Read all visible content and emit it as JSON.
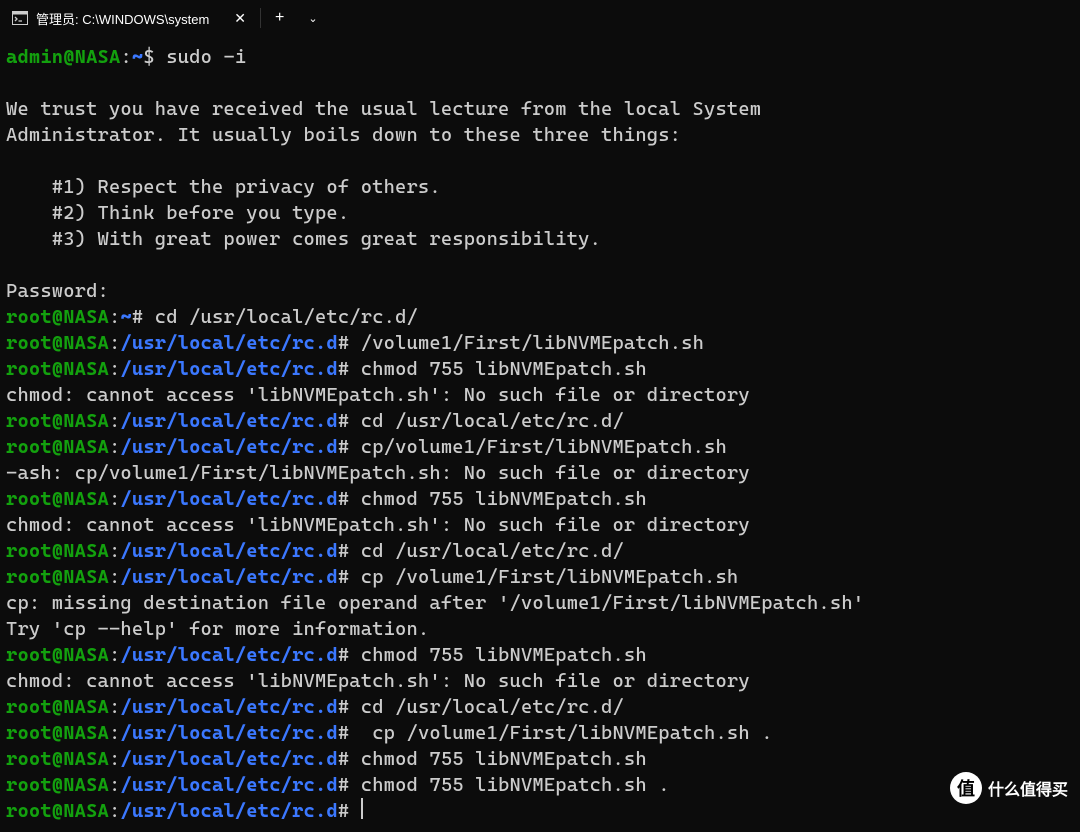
{
  "titlebar": {
    "tab_title": "管理员: C:\\WINDOWS\\system",
    "close_glyph": "✕",
    "new_glyph": "+",
    "dropdown_glyph": "⌄"
  },
  "prompts": {
    "admin_user": "admin@NASA",
    "admin_host_sep": ":",
    "admin_tilde": "~",
    "admin_dollar": "$",
    "root_user": "root@NASA",
    "root_tilde": "~",
    "root_hash": "#",
    "root_path": "/usr/local/etc/rc.d"
  },
  "lines": {
    "cmd_sudo": " sudo -i",
    "blank": "",
    "lecture1": "We trust you have received the usual lecture from the local System",
    "lecture2": "Administrator. It usually boils down to these three things:",
    "lecture3": "    #1) Respect the privacy of others.",
    "lecture4": "    #2) Think before you type.",
    "lecture5": "    #3) With great power comes great responsibility.",
    "password": "Password:",
    "cmd_cd1": " cd /usr/local/etc/rc.d/",
    "cmd_path1": " /volume1/First/libNVMEpatch.sh",
    "cmd_chmod1": " chmod 755 libNVMEpatch.sh",
    "err_chmod": "chmod: cannot access 'libNVMEpatch.sh': No such file or directory",
    "cmd_cd2": " cd /usr/local/etc/rc.d/",
    "cmd_cp_nospace": " cp/volume1/First/libNVMEpatch.sh",
    "err_ash": "-ash: cp/volume1/First/libNVMEpatch.sh: No such file or directory",
    "cmd_chmod2": " chmod 755 libNVMEpatch.sh",
    "cmd_cd3": " cd /usr/local/etc/rc.d/",
    "cmd_cp_nodest": " cp /volume1/First/libNVMEpatch.sh",
    "err_cp1": "cp: missing destination file operand after '/volume1/First/libNVMEpatch.sh'",
    "err_cp2": "Try 'cp --help' for more information.",
    "cmd_chmod3": " chmod 755 libNVMEpatch.sh",
    "cmd_cd4": " cd /usr/local/etc/rc.d/",
    "cmd_cp_ok": "  cp /volume1/First/libNVMEpatch.sh .",
    "cmd_chmod4": " chmod 755 libNVMEpatch.sh",
    "cmd_chmod5": " chmod 755 libNVMEpatch.sh .",
    "cmd_empty": " "
  },
  "watermark": {
    "glyph": "值",
    "text": "什么值得买"
  }
}
